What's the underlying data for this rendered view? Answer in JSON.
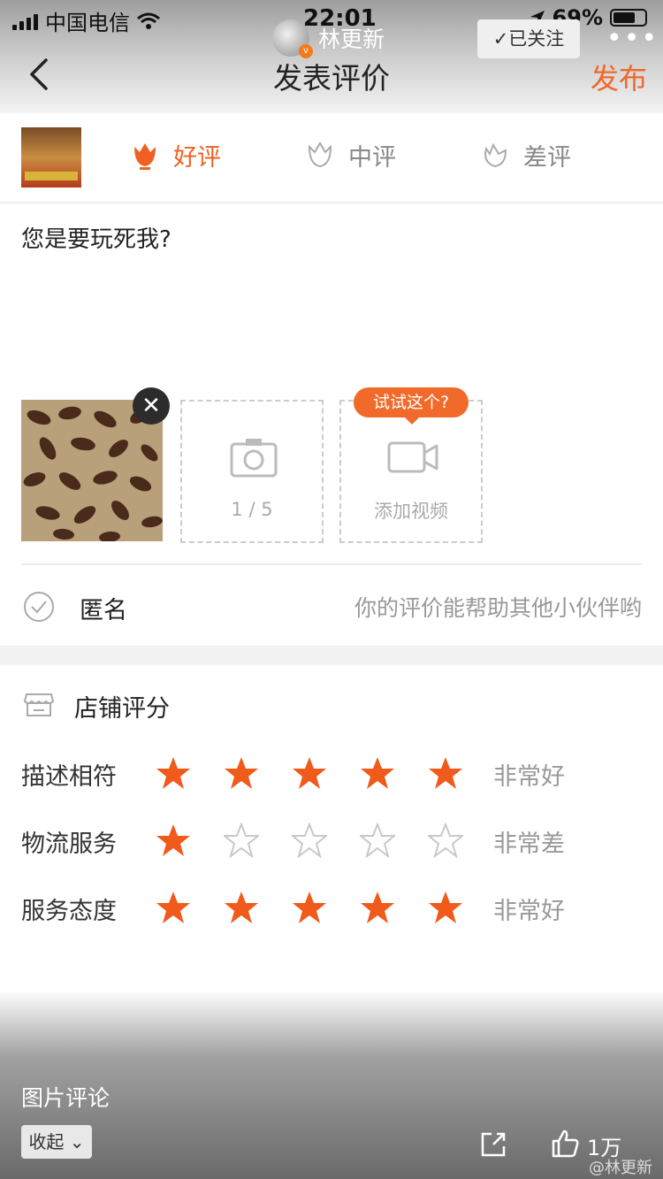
{
  "status": {
    "carrier": "中国电信",
    "time": "22:01",
    "battery": "69%"
  },
  "author": {
    "name": "林更新",
    "follow_label": "已关注",
    "more": "•••"
  },
  "header": {
    "title": "发表评价",
    "publish": "发布"
  },
  "tabs": [
    {
      "label": "好评",
      "selected": true
    },
    {
      "label": "中评",
      "selected": false
    },
    {
      "label": "差评",
      "selected": false
    }
  ],
  "review": {
    "text": "您是要玩死我?"
  },
  "media": {
    "photo_count": "1 / 5",
    "video_label": "添加视频",
    "tip": "试试这个?"
  },
  "anonymous": {
    "label": "匿名",
    "hint": "你的评价能帮助其他小伙伴哟"
  },
  "shop_rating": {
    "title": "店铺评分",
    "rows": [
      {
        "label": "描述相符",
        "stars": 5,
        "text": "非常好"
      },
      {
        "label": "物流服务",
        "stars": 1,
        "text": "非常差"
      },
      {
        "label": "服务态度",
        "stars": 5,
        "text": "非常好"
      }
    ]
  },
  "footer": {
    "title": "图片评论",
    "collapse": "收起",
    "likes": "1万",
    "watermark": "@林更新"
  },
  "colors": {
    "accent": "#f0682a",
    "star_on": "#f05a1a",
    "star_off": "#c8c8c8"
  }
}
